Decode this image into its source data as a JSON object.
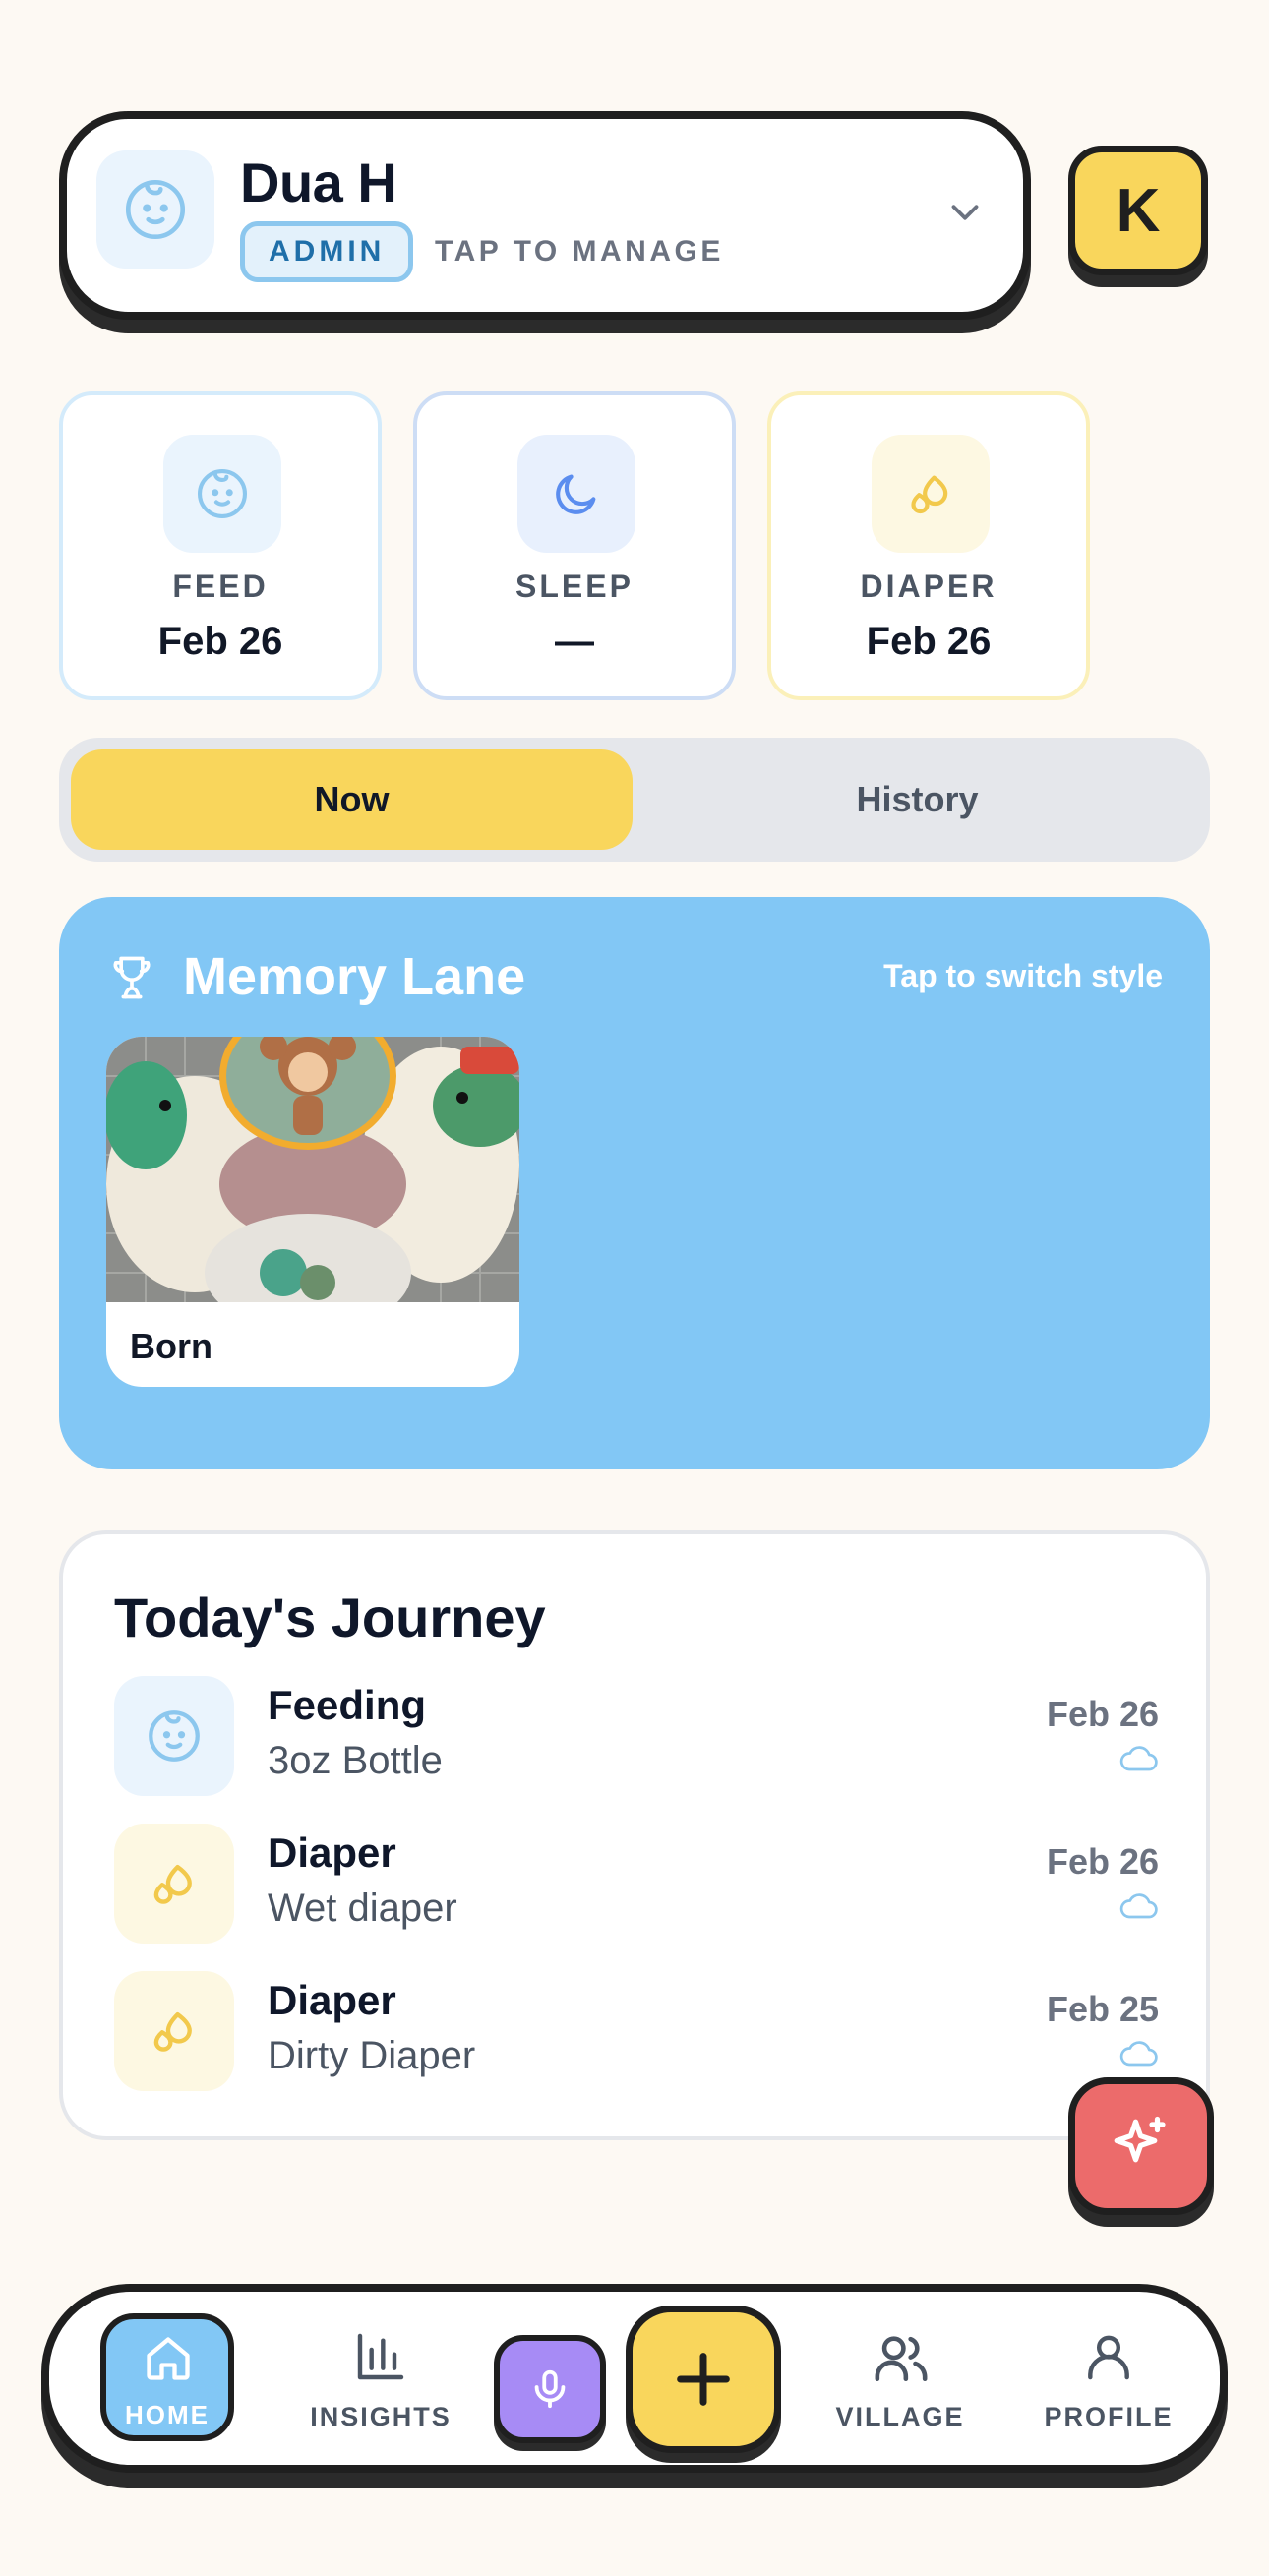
{
  "profile": {
    "name": "Dua H",
    "role_badge": "ADMIN",
    "manage_hint": "TAP TO MANAGE",
    "user_initial": "K"
  },
  "stats": [
    {
      "label": "FEED",
      "value": "Feb 26",
      "icon": "baby-face-icon"
    },
    {
      "label": "SLEEP",
      "value": "—",
      "icon": "moon-icon"
    },
    {
      "label": "DIAPER",
      "value": "Feb 26",
      "icon": "droplets-icon"
    }
  ],
  "segments": {
    "active": "Now",
    "now_label": "Now",
    "history_label": "History"
  },
  "memory_lane": {
    "title": "Memory Lane",
    "switch_hint": "Tap to switch style",
    "cards": [
      {
        "caption": "Born",
        "image": "baby-photo"
      }
    ]
  },
  "journey": {
    "title": "Today's Journey",
    "items": [
      {
        "type": "Feeding",
        "detail": "3oz Bottle",
        "date": "Feb 26",
        "icon": "baby-face-icon",
        "synced_icon": "cloud-icon"
      },
      {
        "type": "Diaper",
        "detail": "Wet diaper",
        "date": "Feb 26",
        "icon": "droplets-icon",
        "synced_icon": "cloud-icon"
      },
      {
        "type": "Diaper",
        "detail": "Dirty Diaper",
        "date": "Feb 25",
        "icon": "droplets-icon",
        "synced_icon": "cloud-icon"
      }
    ]
  },
  "nav": {
    "home": "HOME",
    "insights": "INSIGHTS",
    "village": "VILLAGE",
    "profile": "PROFILE",
    "active": "HOME"
  },
  "colors": {
    "background": "#fdf9f3",
    "accent_yellow": "#f9d65c",
    "accent_blue": "#82c7f5",
    "accent_purple": "#a78bf5",
    "accent_red": "#ec6b6b",
    "outline": "#1f1f1f"
  }
}
